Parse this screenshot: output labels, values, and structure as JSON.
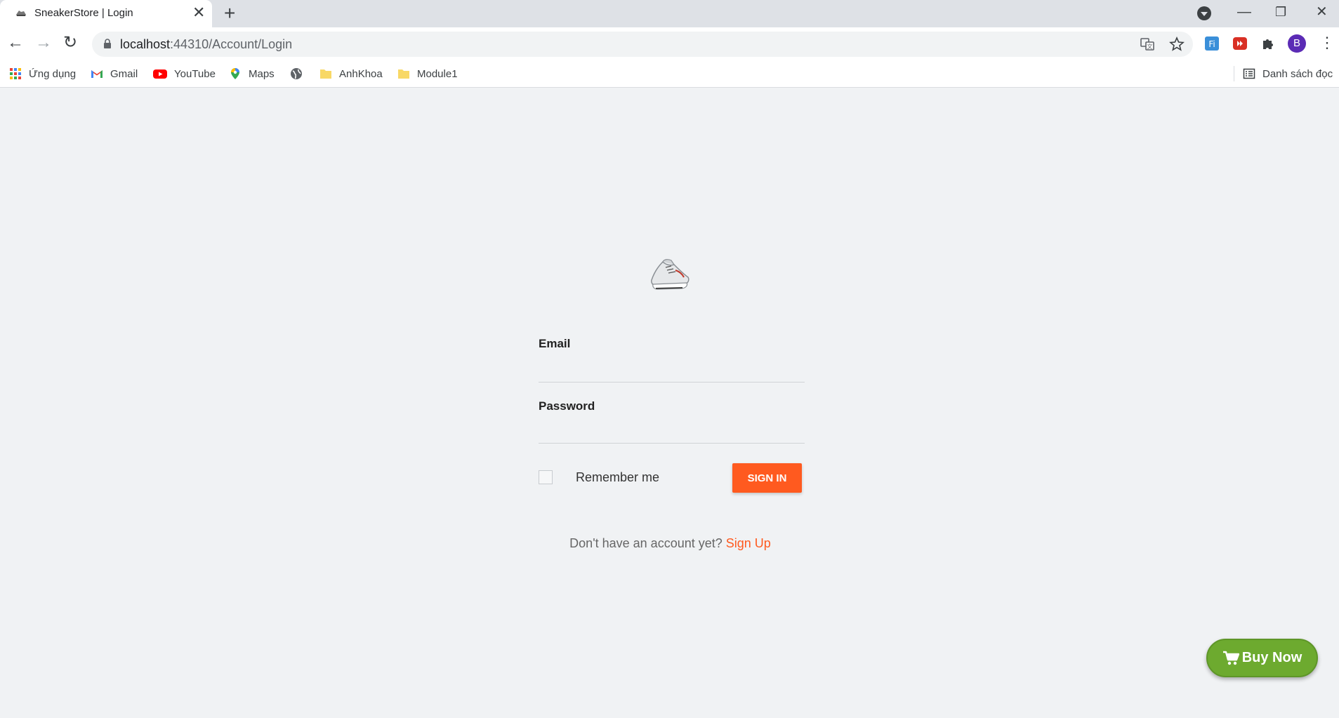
{
  "browser": {
    "tab": {
      "title": "SneakerStore | Login",
      "close_symbol": "✕",
      "favicon": "sneaker-icon"
    },
    "new_tab_symbol": "+",
    "window_controls": {
      "minimize": "—",
      "restore": "❐",
      "close": "✕"
    },
    "nav": {
      "back": "←",
      "forward": "→",
      "reload": "↻"
    },
    "url": {
      "host": "localhost",
      "rest": ":44310/Account/Login"
    },
    "profile_initial": "B",
    "menu_symbol": "⋮",
    "bookmarks": [
      {
        "label": "Ứng dụng",
        "icon": "apps-grid-icon"
      },
      {
        "label": "Gmail",
        "icon": "gmail-icon"
      },
      {
        "label": "YouTube",
        "icon": "youtube-icon"
      },
      {
        "label": "Maps",
        "icon": "maps-pin-icon"
      },
      {
        "label": "",
        "icon": "globe-icon"
      },
      {
        "label": "AnhKhoa",
        "icon": "folder-icon"
      },
      {
        "label": "Module1",
        "icon": "folder-icon"
      }
    ],
    "reading_list": "Danh sách đọc"
  },
  "login": {
    "logo": "sneaker-logo",
    "email_label": "Email",
    "email_value": "",
    "password_label": "Password",
    "password_value": "",
    "remember_label": "Remember me",
    "remember_checked": false,
    "signin_label": "SIGN IN",
    "signup_prompt": "Don't have an account yet?",
    "signup_link": "Sign Up"
  },
  "buy_now": {
    "label": "Buy Now",
    "icon": "cart-icon"
  },
  "colors": {
    "accent": "#ff5a1f",
    "buy_now": "#6daa2f",
    "page_bg": "#f0f2f4"
  }
}
